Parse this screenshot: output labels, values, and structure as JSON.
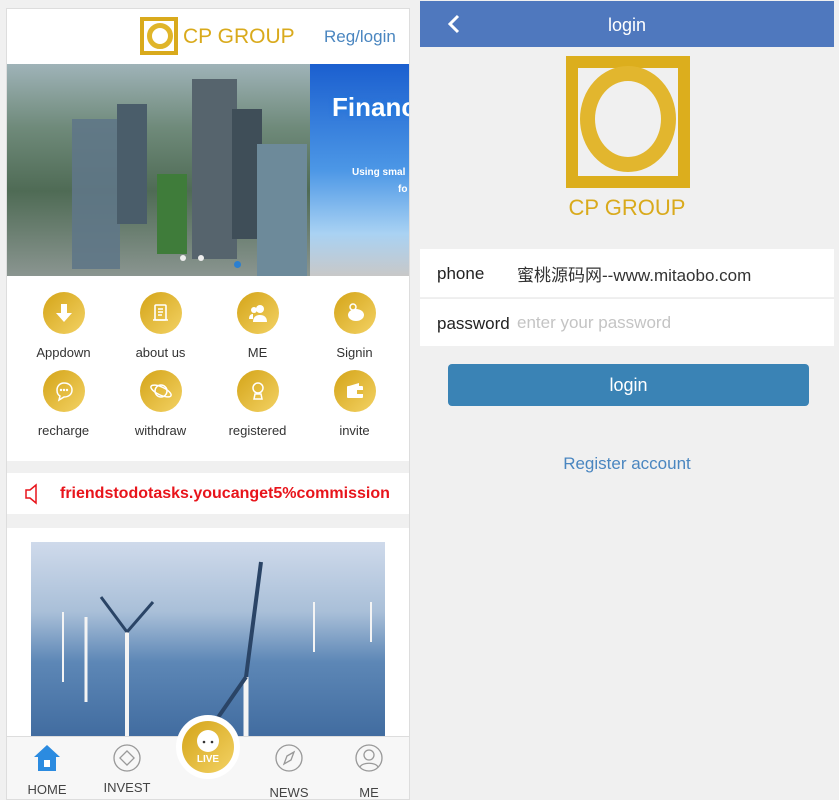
{
  "left": {
    "brand": "CP GROUP",
    "reg_login": "Reg/login",
    "banner": {
      "slide2_title": "Financ",
      "slide2_sub1": "Using smal",
      "slide2_sub2": "fo",
      "dots": 4,
      "active_dot": 4
    },
    "grid": [
      {
        "label": "Appdown",
        "icon": "download-icon"
      },
      {
        "label": "about us",
        "icon": "scroll-icon"
      },
      {
        "label": "ME",
        "icon": "users-icon"
      },
      {
        "label": "Signin",
        "icon": "piggy-bank-icon"
      },
      {
        "label": "recharge",
        "icon": "chat-icon"
      },
      {
        "label": "withdraw",
        "icon": "planet-icon"
      },
      {
        "label": "registered",
        "icon": "robot-icon"
      },
      {
        "label": "invite",
        "icon": "wallet-icon"
      }
    ],
    "notice": "friendstodotasks.youcanget5%commission",
    "nav": [
      {
        "label": "HOME",
        "icon": "home-icon",
        "active": true
      },
      {
        "label": "INVEST",
        "icon": "diamond-icon"
      },
      {
        "label": "LIVE",
        "icon": "customer-service-icon"
      },
      {
        "label": "NEWS",
        "icon": "compass-icon"
      },
      {
        "label": "ME",
        "icon": "user-icon"
      }
    ]
  },
  "right": {
    "title": "login",
    "brand": "CP GROUP",
    "phone_label": "phone",
    "phone_value": "蜜桃源码网--www.mitaobo.com",
    "password_label": "password",
    "password_placeholder": "enter your password",
    "login_button": "login",
    "register_link": "Register account"
  },
  "colors": {
    "gold": "#d9aa1c",
    "header_blue": "#4f78be",
    "button_blue": "#3a83b5",
    "notice_red": "#e8141b",
    "link_blue": "#4a86c0"
  }
}
